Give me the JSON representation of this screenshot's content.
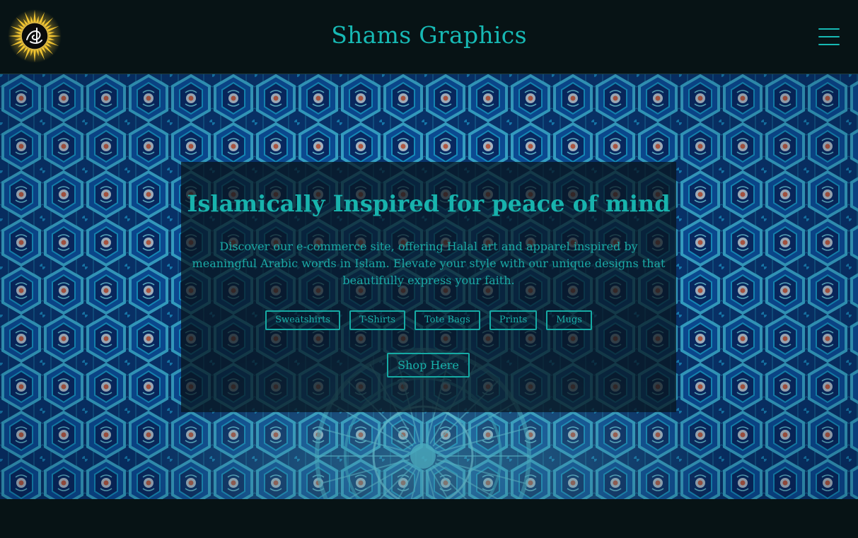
{
  "header": {
    "logo_icon": "sun-calligraphy-logo-icon",
    "title": "Shams Graphics",
    "menu_icon": "hamburger-menu-icon"
  },
  "hero": {
    "background": "islamic-mosaic-tile-ceiling",
    "heading": "Islamically Inspired for peace of mind",
    "description": "Discover our e-commerce site, offering Halal art and apparel inspired by meaningful Arabic words in Islam. Elevate your style with our unique designs that beautifully express your faith.",
    "categories": [
      "Sweatshirts",
      "T-Shirts",
      "Tote Bags",
      "Prints",
      "Mugs"
    ],
    "cta_label": "Shop Here"
  },
  "colors": {
    "accent": "#17b9b4",
    "header_bg": "#071315",
    "card_bg": "rgba(8,22,30,0.74)",
    "logo_gold": "#f2c531"
  }
}
